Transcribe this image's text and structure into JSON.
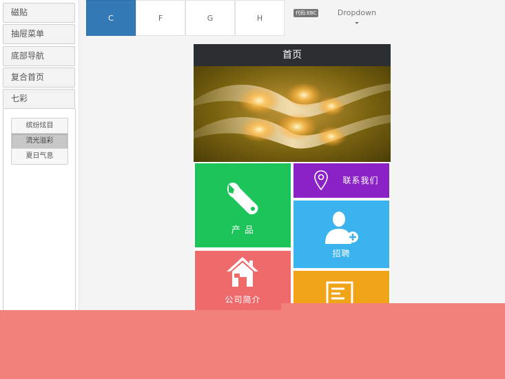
{
  "sidebar": {
    "items": [
      {
        "label": "磁贴"
      },
      {
        "label": "抽屉菜单"
      },
      {
        "label": "底部导航"
      },
      {
        "label": "复合首页"
      },
      {
        "label": "七彩"
      }
    ],
    "sub_items": [
      {
        "label": "缤纷炫目"
      },
      {
        "label": "流光溢彩"
      },
      {
        "label": "夏日气息"
      }
    ]
  },
  "tabs": [
    {
      "label": "C"
    },
    {
      "label": "F"
    },
    {
      "label": "G"
    },
    {
      "label": "H"
    }
  ],
  "code_badge": "代码:EBC",
  "dropdown": {
    "label": "Dropdown"
  },
  "phone": {
    "title": "首页",
    "tiles": {
      "product": "产 品",
      "contact": "联系我们",
      "recruit": "招聘",
      "about": "公司简介"
    }
  },
  "colors": {
    "accent": "#337ab7",
    "header": "#2b2f31",
    "product": "#1dc45a",
    "contact": "#8b22c6",
    "recruit": "#3ab3ef",
    "about": "#ef6b6b",
    "news": "#f0a418",
    "overlay": "#f2807b"
  },
  "icons": [
    "wrench-icon",
    "location-pin-icon",
    "user-add-icon",
    "house-icon",
    "document-icon",
    "caret-down-icon"
  ]
}
